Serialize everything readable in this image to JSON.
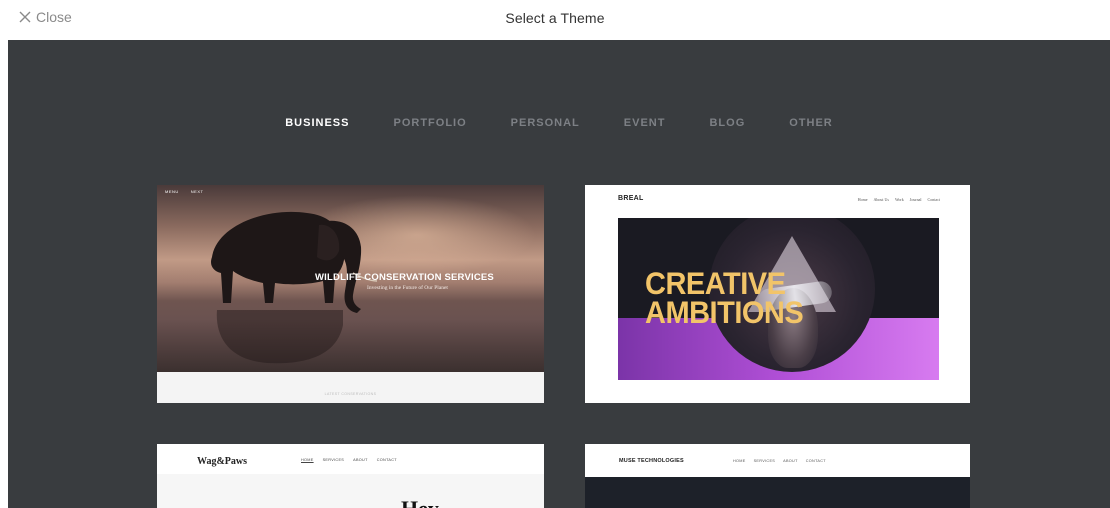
{
  "header": {
    "close_label": "Close",
    "title": "Select a Theme"
  },
  "tabs": [
    {
      "label": "BUSINESS",
      "active": true
    },
    {
      "label": "PORTFOLIO",
      "active": false
    },
    {
      "label": "PERSONAL",
      "active": false
    },
    {
      "label": "EVENT",
      "active": false
    },
    {
      "label": "BLOG",
      "active": false
    },
    {
      "label": "OTHER",
      "active": false
    }
  ],
  "themes": {
    "wildlife": {
      "nav": [
        "MENU",
        "NEXT"
      ],
      "title": "WILDLIFE CONSERVATION SERVICES",
      "subtitle": "Investing in the Future of Our Planet",
      "footer": "LATEST CONSERVATIONS"
    },
    "breal": {
      "logo": "BREAL",
      "nav": [
        "Home",
        "About Us",
        "Work",
        "Journal",
        "Contact"
      ],
      "headline_1": "CREATIVE",
      "headline_2": "AMBITIONS"
    },
    "wagpaws": {
      "logo": "Wag&Paws",
      "nav": [
        "HOME",
        "SERVICES",
        "ABOUT",
        "CONTACT"
      ],
      "heading": "Hey"
    },
    "muse": {
      "logo": "MUSE TECHNOLOGIES",
      "nav": [
        "HOME",
        "SERVICES",
        "ABOUT",
        "CONTACT"
      ]
    }
  },
  "colors": {
    "stage_bg": "#393c3f",
    "tab_active": "#ffffff",
    "tab_inactive": "#7d8085",
    "breal_accent": "#f2c469"
  }
}
